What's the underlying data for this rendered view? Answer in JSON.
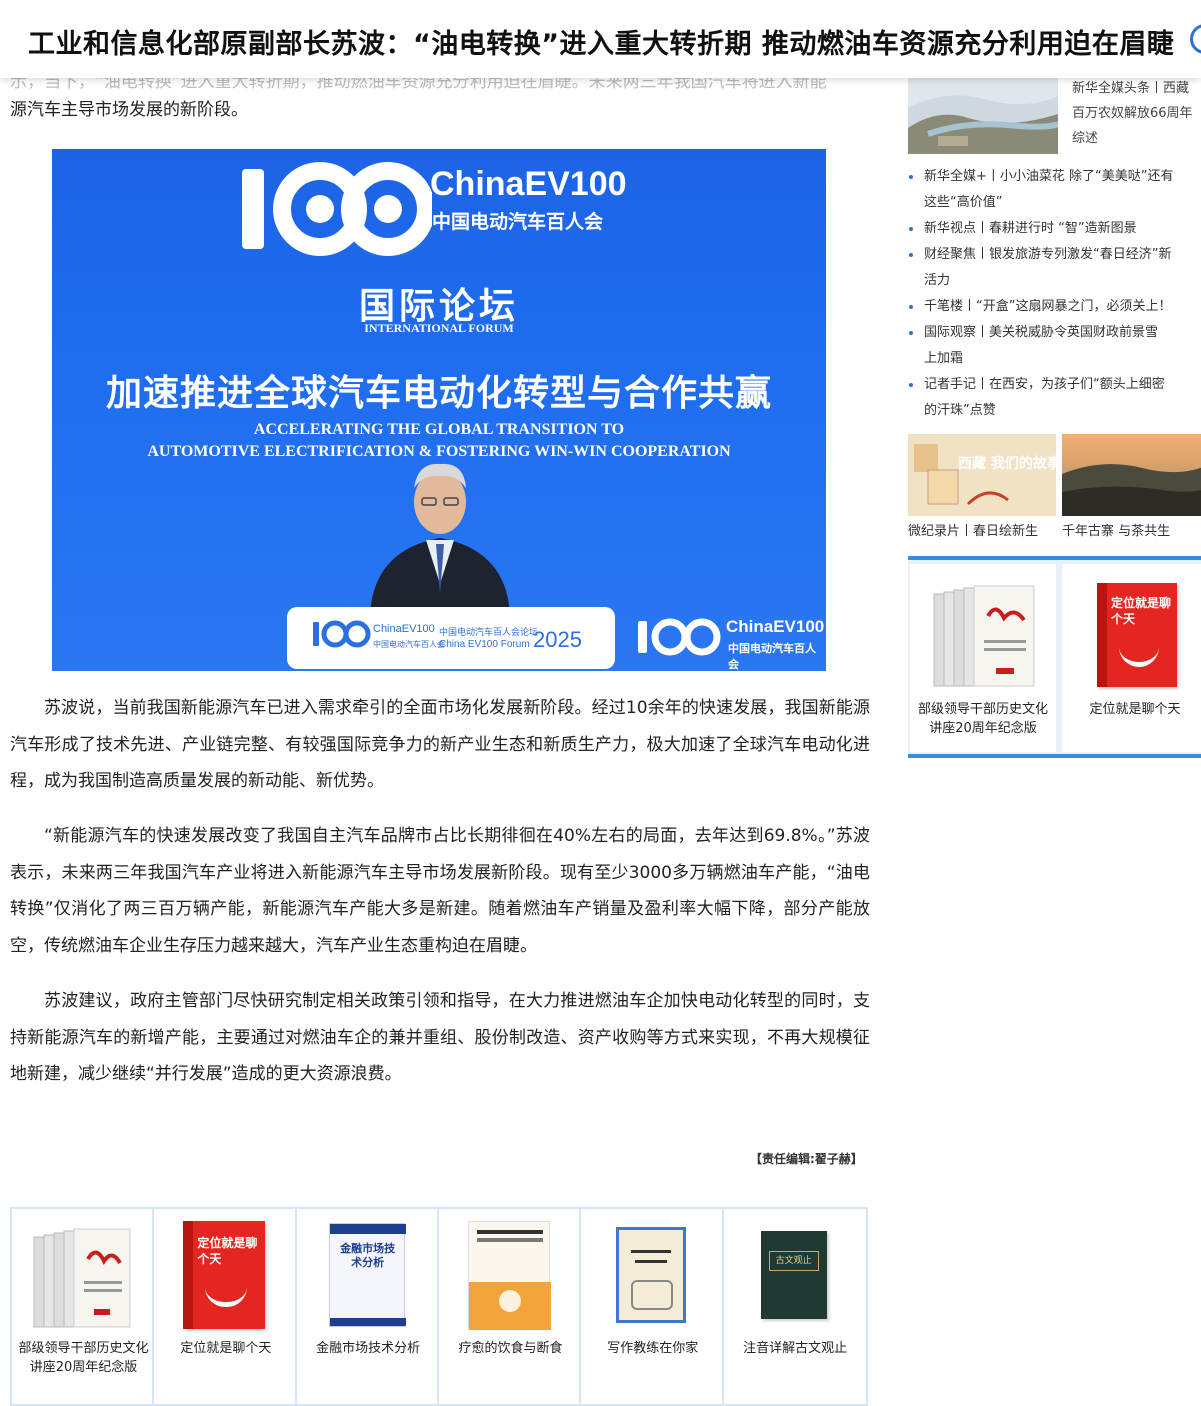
{
  "header": {
    "title": "工业和信息化部原副部长苏波：“油电转换”进入重大转折期 推动燃油车资源充分利用迫在眉睫"
  },
  "article": {
    "faded_line": "示，当下，“油电转换”进入重大转折期，推动燃油车资源充分利用迫在眉睫。未来两三年我国汽车将进入新能",
    "intro_tail": "源汽车主导市场发展的新阶段。",
    "hero": {
      "logo_en": "ChinaEV100",
      "logo_cn": "中国电动汽车百人会",
      "forum_cn": "国际论坛",
      "forum_en": "INTERNATIONAL FORUM",
      "theme_cn": "加速推进全球汽车电动化转型与合作共赢",
      "theme_en_1": "ACCELERATING THE GLOBAL TRANSITION TO",
      "theme_en_2": "AUTOMOTIVE ELECTRIFICATION & FOSTERING WIN-WIN COOPERATION",
      "podium_ev": "ChinaEV100",
      "podium_sub": "中国电动汽车百人会",
      "podium_forum_cn": "中国电动汽车百人会论坛",
      "podium_forum_en": "China EV100 Forum",
      "podium_year": "2025"
    },
    "paragraphs": [
      "苏波说，当前我国新能源汽车已进入需求牵引的全面市场化发展新阶段。经过10余年的快速发展，我国新能源汽车形成了技术先进、产业链完整、有较强国际竞争力的新产业生态和新质生产力，极大加速了全球汽车电动化进程，成为我国制造高质量发展的新动能、新优势。",
      "“新能源汽车的快速发展改变了我国自主汽车品牌市占比长期徘徊在40%左右的局面，去年达到69.8%。”苏波表示，未来两三年我国汽车产业将进入新能源汽车主导市场发展新阶段。现有至少3000多万辆燃油车产能，“油电转换”仅消化了两三百万辆产能，新能源汽车产能大多是新建。随着燃油车产销量及盈利率大幅下降，部分产能放空，传统燃油车企业生存压力越来越大，汽车产业生态重构迫在眉睫。",
      "苏波建议，政府主管部门尽快研究制定相关政策引领和指导，在大力推进燃油车企加快电动化转型的同时，支持新能源汽车的新增产能，主要通过对燃油车企的兼并重组、股份制改造、资产收购等方式来实现，不再大规模征地新建，减少继续“并行发展”造成的更大资源浪费。"
    ],
    "editor": "【责任编辑:翟子赫】"
  },
  "bottom_books": [
    {
      "title": "部级领导干部历史文化讲座20周年纪念版"
    },
    {
      "title": "定位就是聊个天"
    },
    {
      "title": "金融市场技术分析"
    },
    {
      "title": "疗愈的饮食与断食"
    },
    {
      "title": "写作教练在你家"
    },
    {
      "title": "注音详解古文观止"
    }
  ],
  "bottom_book_cover_text": {
    "positioning": "定位就是聊个天",
    "finance": "金融市场技术分析",
    "ancient": "古文观止"
  },
  "sidebar": {
    "top_text": [
      "新华全媒头条丨西藏",
      "百万农奴解放66周年",
      "综述"
    ],
    "news": [
      [
        "新华全媒+丨小小油菜花 除了“美美哒”还有",
        "这些“高价值”"
      ],
      [
        "新华视点丨春耕进行时 “智”造新图景"
      ],
      [
        "财经聚焦丨银发旅游专列激发“春日经济”新",
        "活力"
      ],
      [
        "千笔楼丨“开盒”这扇网暴之门，必须关上！"
      ],
      [
        "国际观察丨美关税威胁令英国财政前景雪",
        "上加霜"
      ],
      [
        "记者手记丨在西安，为孩子们“额头上细密",
        "的汗珠”点赞"
      ]
    ],
    "photos": [
      {
        "caption": "微纪录片丨春日绘新生",
        "overlay": "西藏 我们的故事"
      },
      {
        "caption": "千年古寨 与茶共生"
      }
    ],
    "books": [
      {
        "title": "部级领导干部历史文化讲座20周年纪念版"
      },
      {
        "title": "定位就是聊个天"
      }
    ]
  },
  "colors": {
    "hero_blue": "#1f6ef0",
    "link_blue": "#2f6fd6",
    "panel_border": "#d6e6f6",
    "sidebar_accent": "#3a8ad8"
  }
}
